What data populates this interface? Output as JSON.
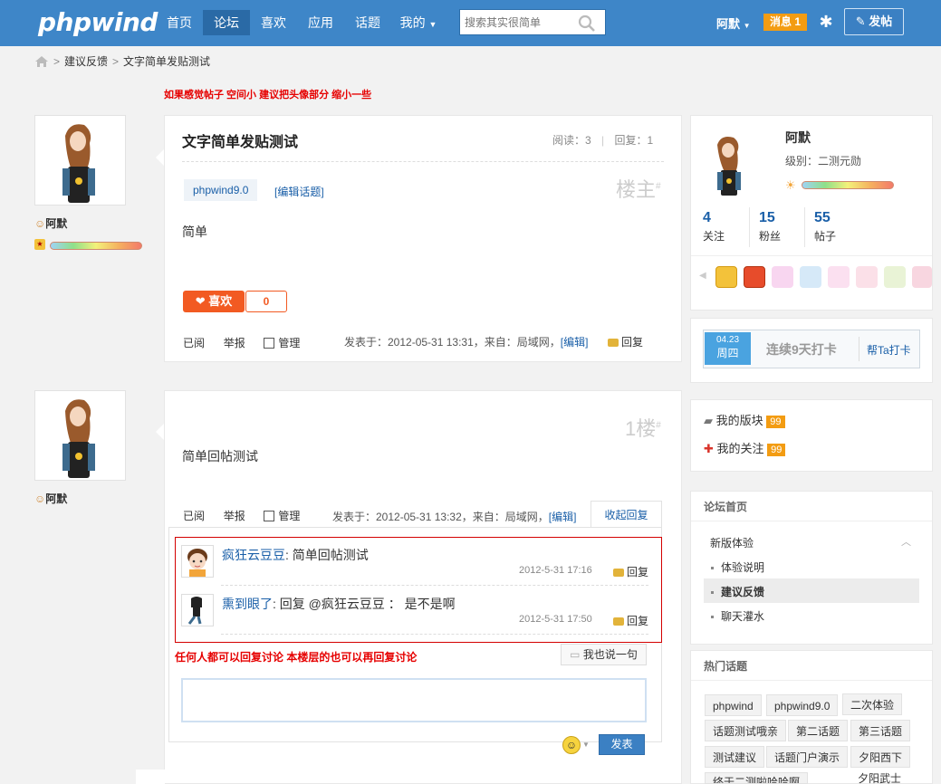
{
  "header": {
    "logo": "phpwind",
    "nav": [
      "首页",
      "论坛",
      "喜欢",
      "应用",
      "话题",
      "我的"
    ],
    "search_placeholder": "搜索其实很简单",
    "user": "阿默",
    "messages": "消息 1",
    "post_button": "发帖"
  },
  "breadcrumb": [
    "建议反馈",
    "文字简单发贴测试"
  ],
  "notice_top": "如果感觉帖子 空间小 建议把头像部分 缩小一些",
  "thread": {
    "title": "文字简单发贴测试",
    "reads": "阅读：3",
    "replies": "回复：1",
    "topic_tag": "phpwind9.0",
    "edit_topic": "[编辑话题]",
    "floor": "楼主",
    "content": "简单",
    "like_label": "喜欢",
    "like_count": "0",
    "actions": {
      "read": "已阅",
      "report": "举报",
      "manage": "管理"
    },
    "meta_posted": "发表于：2012-05-31 13:31，来自：局域网，",
    "meta_edit": "[编辑]",
    "reply": "回复"
  },
  "author": {
    "name": "阿默"
  },
  "post2": {
    "floor": "1楼",
    "content": "简单回帖测试",
    "meta_posted": "发表于：2012-05-31 13:32，来自：局域网，",
    "meta_edit": "[编辑]",
    "collapse": "收起回复",
    "comments": [
      {
        "user": "疯狂云豆豆",
        "text": "简单回帖测试",
        "time": "2012-5-31  17:16",
        "reply": "回复"
      },
      {
        "user": "熏到眼了",
        "text": "回复 @疯狂云豆豆 ： 是不是啊",
        "time": "2012-5-31  17:50",
        "reply": "回复"
      }
    ],
    "notice": "任何人都可以回复讨论 本楼层的也可以再回复讨论",
    "say_button": "我也说一句",
    "submit": "发表"
  },
  "profile": {
    "name": "阿默",
    "level": "级别：二测元勋",
    "stats": [
      {
        "value": "4",
        "label": "关注"
      },
      {
        "value": "15",
        "label": "粉丝"
      },
      {
        "value": "55",
        "label": "帖子"
      }
    ]
  },
  "checkin": {
    "date": "04.23",
    "weekday": "周四",
    "streak": "连续9天打卡",
    "help": "帮Ta打卡"
  },
  "my_links": [
    {
      "label": "我的版块",
      "count": "99"
    },
    {
      "label": "我的关注",
      "count": "99"
    }
  ],
  "forum_nav": {
    "title": "论坛首页",
    "group": "新版体验",
    "items": [
      "体验说明",
      "建议反馈",
      "聊天灌水"
    ]
  },
  "hot_topics": {
    "title": "热门话题",
    "tags": [
      "phpwind",
      "phpwind9.0",
      "二次体验",
      "话题测试哦亲",
      "第二话题",
      "第三话题",
      "测试建议",
      "话题门户演示",
      "夕阳西下",
      "终于二测啦哈哈啊",
      "夕阳武士"
    ]
  },
  "colors": {
    "brand": "#3e86c8",
    "accent": "#f39c12",
    "like": "#f25a22",
    "notice": "#e60000"
  }
}
